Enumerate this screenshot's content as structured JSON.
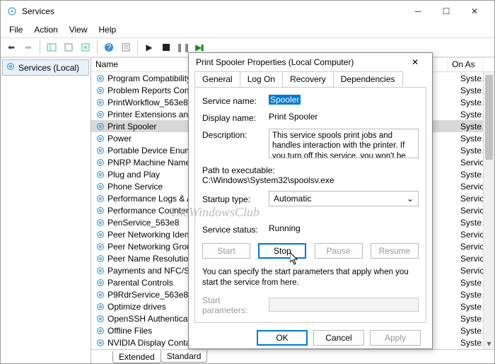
{
  "window": {
    "title": "Services",
    "menu": {
      "file": "File",
      "action": "Action",
      "view": "View",
      "help": "Help"
    }
  },
  "tree": {
    "root": "Services (Local)"
  },
  "grid": {
    "col_name": "Name",
    "col_onas": "On As",
    "rows": [
      {
        "name": "Program Compatibility A…",
        "onas": "Syste…"
      },
      {
        "name": "Problem Reports Contro…",
        "onas": "Syste…"
      },
      {
        "name": "PrintWorkflow_563e8",
        "onas": "Syste…"
      },
      {
        "name": "Printer Extensions and N…",
        "onas": "Syste…"
      },
      {
        "name": "Print Spooler",
        "onas": "Syste…",
        "selected": true
      },
      {
        "name": "Power",
        "onas": "Syste…"
      },
      {
        "name": "Portable Device Enumer…",
        "onas": "Syste…"
      },
      {
        "name": "PNRP Machine Name Pu…",
        "onas": "Service"
      },
      {
        "name": "Plug and Play",
        "onas": "Syste…"
      },
      {
        "name": "Phone Service",
        "onas": "Service"
      },
      {
        "name": "Performance Logs & Ale…",
        "onas": "Service"
      },
      {
        "name": "Performance Counter Dl…",
        "onas": "Service"
      },
      {
        "name": "PenService_563e8",
        "onas": "Syste…"
      },
      {
        "name": "Peer Networking Identity…",
        "onas": "Service"
      },
      {
        "name": "Peer Networking Groupi…",
        "onas": "Service"
      },
      {
        "name": "Peer Name Resolution Pr…",
        "onas": "Service"
      },
      {
        "name": "Payments and NFC/SE M…",
        "onas": "Service"
      },
      {
        "name": "Parental Controls",
        "onas": "Syste…"
      },
      {
        "name": "P9RdrService_563e8",
        "onas": "Syste…"
      },
      {
        "name": "Optimize drives",
        "onas": "Syste…"
      },
      {
        "name": "OpenSSH Authentication…",
        "onas": "Syste…"
      },
      {
        "name": "Offline Files",
        "onas": "Syste…"
      },
      {
        "name": "NVIDIA Display Container…",
        "onas": "Syste…"
      }
    ],
    "tabs": {
      "extended": "Extended",
      "standard": "Standard"
    }
  },
  "dialog": {
    "title": "Print Spooler Properties (Local Computer)",
    "tabs": {
      "general": "General",
      "logon": "Log On",
      "recovery": "Recovery",
      "deps": "Dependencies"
    },
    "labels": {
      "service_name": "Service name:",
      "display_name": "Display name:",
      "description": "Description:",
      "path": "Path to executable:",
      "startup_type": "Startup type:",
      "service_status": "Service status:",
      "start_parameters": "Start parameters:"
    },
    "values": {
      "service_name": "Spooler",
      "display_name": "Print Spooler",
      "description": "This service spools print jobs and handles interaction with the printer.  If you turn off this service, you won't be able to print or see your printers",
      "path": "C:\\Windows\\System32\\spoolsv.exe",
      "startup_type": "Automatic",
      "service_status": "Running"
    },
    "buttons": {
      "start": "Start",
      "stop": "Stop",
      "pause": "Pause",
      "resume": "Resume"
    },
    "note": "You can specify the start parameters that apply when you start the service from here.",
    "footer": {
      "ok": "OK",
      "cancel": "Cancel",
      "apply": "Apply"
    }
  },
  "watermark": "TheWindowsClub"
}
